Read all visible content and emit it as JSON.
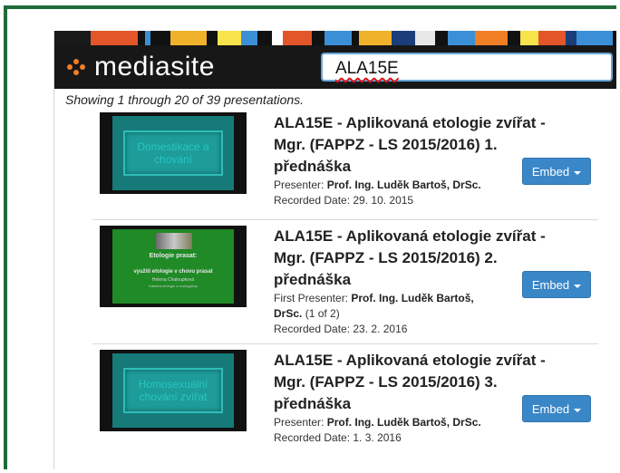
{
  "header": {
    "logo_text": "mediasite",
    "search_value": "ALA15E"
  },
  "showing_text": "Showing 1 through 20 of 39 presentations.",
  "results": [
    {
      "title": "ALA15E - Aplikovaná etologie zvířat - Mgr. (FAPPZ - LS 2015/2016) 1. přednáška",
      "presenter_label": "Presenter:",
      "presenter": "Prof. Ing. Luděk Bartoš, DrSc.",
      "recorded": "Recorded Date: 29. 10. 2015",
      "thumb_text": "Domestikace a chování",
      "embed": "Embed"
    },
    {
      "title": "ALA15E - Aplikovaná etologie zvířat - Mgr. (FAPPZ - LS 2015/2016) 2. přednáška",
      "presenter_label": "First Presenter:",
      "presenter": "Prof. Ing. Luděk Bartoš, DrSc.",
      "presenter_suffix": "(1 of 2)",
      "recorded": "Recorded Date: 23. 2. 2016",
      "thumb_lines": [
        "Etologie prasat:",
        "využití etologie v chovu prasat",
        "Helena Chaloupková",
        "Katedra etologie a zoohygieny"
      ],
      "embed": "Embed"
    },
    {
      "title": "ALA15E - Aplikovaná etologie zvířat - Mgr. (FAPPZ - LS 2015/2016) 3. přednáška",
      "presenter_label": "Presenter:",
      "presenter": "Prof. Ing. Luděk Bartoš, DrSc.",
      "recorded": "Recorded Date: 1. 3. 2016",
      "thumb_text": "Homosexuální chování zvířat",
      "embed": "Embed"
    }
  ],
  "colors": {
    "frame_green": "#1f6b3a",
    "header_bg": "#171717",
    "logo_orange": "#f07e25",
    "embed_blue": "#3a87c8"
  }
}
